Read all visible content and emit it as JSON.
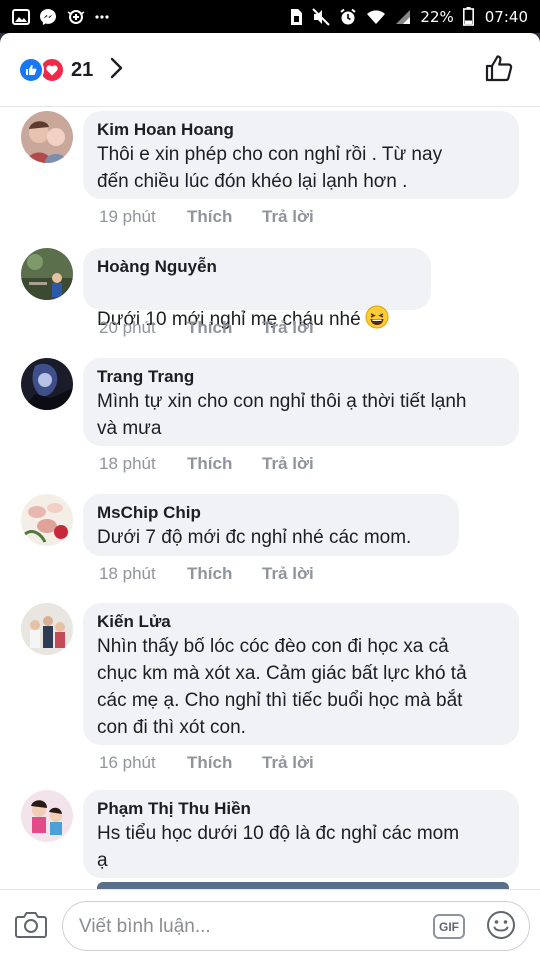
{
  "status_bar": {
    "battery": "22%",
    "time": "07:40"
  },
  "reactions": {
    "count": "21"
  },
  "comments": [
    {
      "name": "Kim Hoan Hoang",
      "text": "Thôi e xin phép cho con nghỉ rồi . Từ nay\nđến chiều lúc đón khéo lại lạnh hơn .",
      "time": "19 phút",
      "like": "Thích",
      "reply": "Trả lời"
    },
    {
      "name": "Hoàng Nguyễn",
      "text": "Dưới 10 mới nghỉ mẹ cháu nhé",
      "time": "20 phút",
      "like": "Thích",
      "reply": "Trả lời"
    },
    {
      "name": "Trang Trang",
      "text": "Mình tự xin cho con nghỉ thôi ạ thời tiết lạnh\nvà mưa",
      "time": "18 phút",
      "like": "Thích",
      "reply": "Trả lời"
    },
    {
      "name": "MsChip Chip",
      "text": "Dưới 7 độ mới đc nghỉ nhé các mom.",
      "time": "18 phút",
      "like": "Thích",
      "reply": "Trả lời"
    },
    {
      "name": "Kiến Lửa",
      "text": "Nhìn thấy bố lóc cóc đèo con đi học xa cả\nchục km mà xót xa. Cảm giác bất lực khó tả\ncác mẹ ạ. Cho nghỉ thì tiếc buổi học mà bắt\ncon đi thì xót con.",
      "time": "16 phút",
      "like": "Thích",
      "reply": "Trả lời"
    },
    {
      "name": "Phạm Thị Thu Hiền",
      "text": "Hs tiểu học dưới 10 độ là đc nghỉ các mom\nạ",
      "time": "",
      "like": "",
      "reply": ""
    }
  ],
  "composer": {
    "placeholder": "Viết bình luận...",
    "gif_label": "GIF"
  },
  "colors": {
    "like_blue": "#1877f2",
    "love_red": "#f0284a",
    "bubble_bg": "#f0f2f5",
    "meta_gray": "#90949c"
  },
  "icons": [
    "gallery-icon",
    "messenger-icon",
    "data-saver-icon",
    "more-dots-icon",
    "sim-icon",
    "mute-icon",
    "alarm-icon",
    "wifi-icon",
    "signal-icon",
    "battery-icon",
    "like-reaction-icon",
    "love-reaction-icon",
    "chevron-right-icon",
    "thumbs-up-icon",
    "camera-icon",
    "emoji-icon"
  ]
}
